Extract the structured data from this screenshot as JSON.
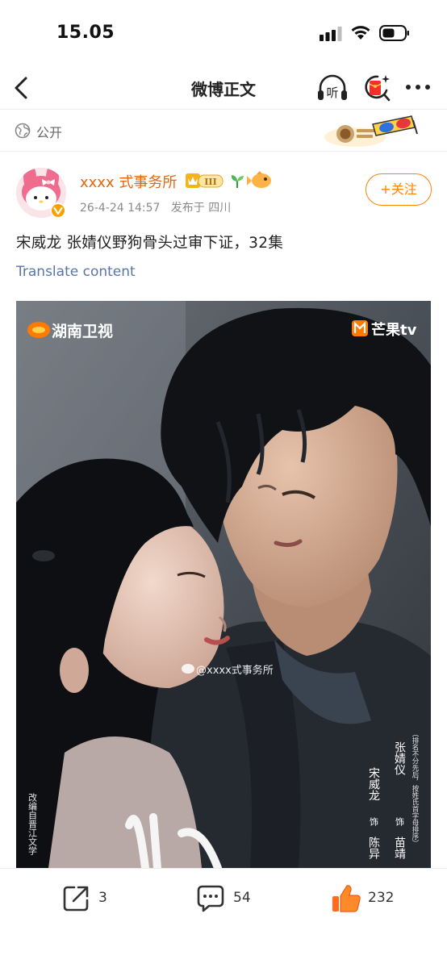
{
  "status_bar": {
    "time": "15.05"
  },
  "nav": {
    "title": "微博正文",
    "listen_label": "听"
  },
  "visibility": {
    "label": "公开"
  },
  "author": {
    "name": "xxxx 式事务所",
    "timestamp": "26-4-24 14:57",
    "location": "发布于 四川",
    "badge_level": "III"
  },
  "follow_label": "+关注",
  "post": {
    "text": "宋威龙 张婧仪野狗骨头过审下证，32集",
    "translate_label": "Translate content"
  },
  "poster": {
    "channel_left": "湖南卫视",
    "channel_right": "芒果tv",
    "watermark": "@xxxx式事务所",
    "credits_actors": [
      "宋威龙",
      "张婧仪"
    ],
    "credits_roles": [
      "饰",
      "饰"
    ],
    "credits_characters": [
      "陈异",
      "苗靖"
    ],
    "credits_note": "（排名不分先后，按姓氏首字母排序）",
    "adapted_from": "改编自晋江文学"
  },
  "actions": {
    "share_count": "3",
    "comment_count": "54",
    "like_count": "232"
  },
  "colors": {
    "accent": "#ff8200",
    "link": "#5b74a6",
    "username": "#e8650a"
  }
}
